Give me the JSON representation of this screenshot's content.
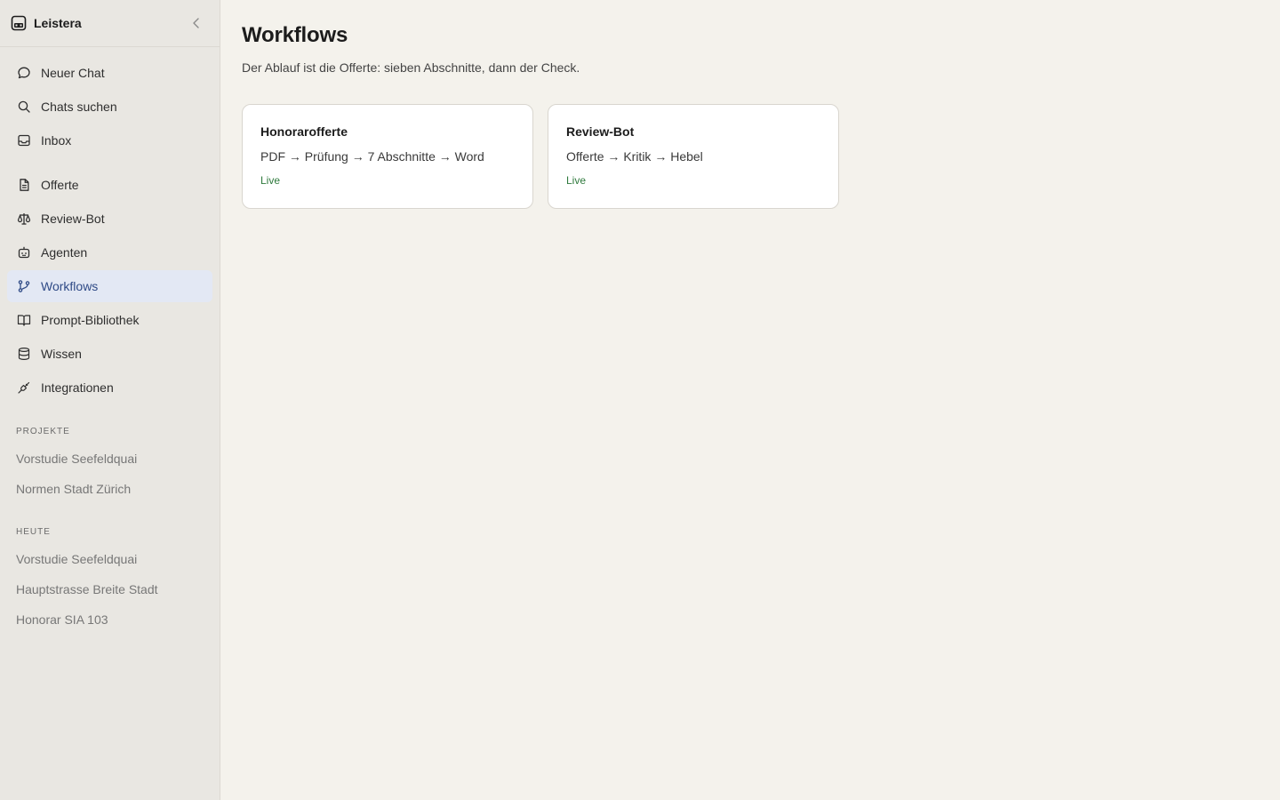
{
  "app": {
    "name": "Leistera"
  },
  "sidebar": {
    "primary": [
      {
        "label": "Neuer Chat",
        "icon": "chat-bubble-icon"
      },
      {
        "label": "Chats suchen",
        "icon": "search-icon"
      },
      {
        "label": "Inbox",
        "icon": "inbox-icon"
      }
    ],
    "tools": [
      {
        "label": "Offerte",
        "icon": "document-icon"
      },
      {
        "label": "Review-Bot",
        "icon": "scale-icon"
      },
      {
        "label": "Agenten",
        "icon": "robot-icon"
      },
      {
        "label": "Workflows",
        "icon": "git-branch-icon",
        "active": true
      },
      {
        "label": "Prompt-Bibliothek",
        "icon": "book-icon"
      },
      {
        "label": "Wissen",
        "icon": "database-icon"
      },
      {
        "label": "Integrationen",
        "icon": "plug-icon"
      }
    ],
    "projects_title": "PROJEKTE",
    "projects": [
      "Vorstudie Seefeldquai",
      "Normen Stadt Zürich"
    ],
    "today_title": "HEUTE",
    "today": [
      "Vorstudie Seefeldquai",
      "Hauptstrasse Breite Stadt",
      "Honorar SIA 103"
    ]
  },
  "main": {
    "title": "Workflows",
    "subtitle": "Der Ablauf ist die Offerte: sieben Abschnitte, dann der Check.",
    "cards": [
      {
        "title": "Honorarofferte",
        "flow": "PDF → Prüfung → 7 Abschnitte → Word",
        "status": "Live"
      },
      {
        "title": "Review-Bot",
        "flow": "Offerte → Kritik → Hebel",
        "status": "Live"
      }
    ]
  },
  "colors": {
    "active_bg": "#e3e8f4",
    "active_text": "#2f4a86",
    "live_green": "#2f7a3d"
  }
}
